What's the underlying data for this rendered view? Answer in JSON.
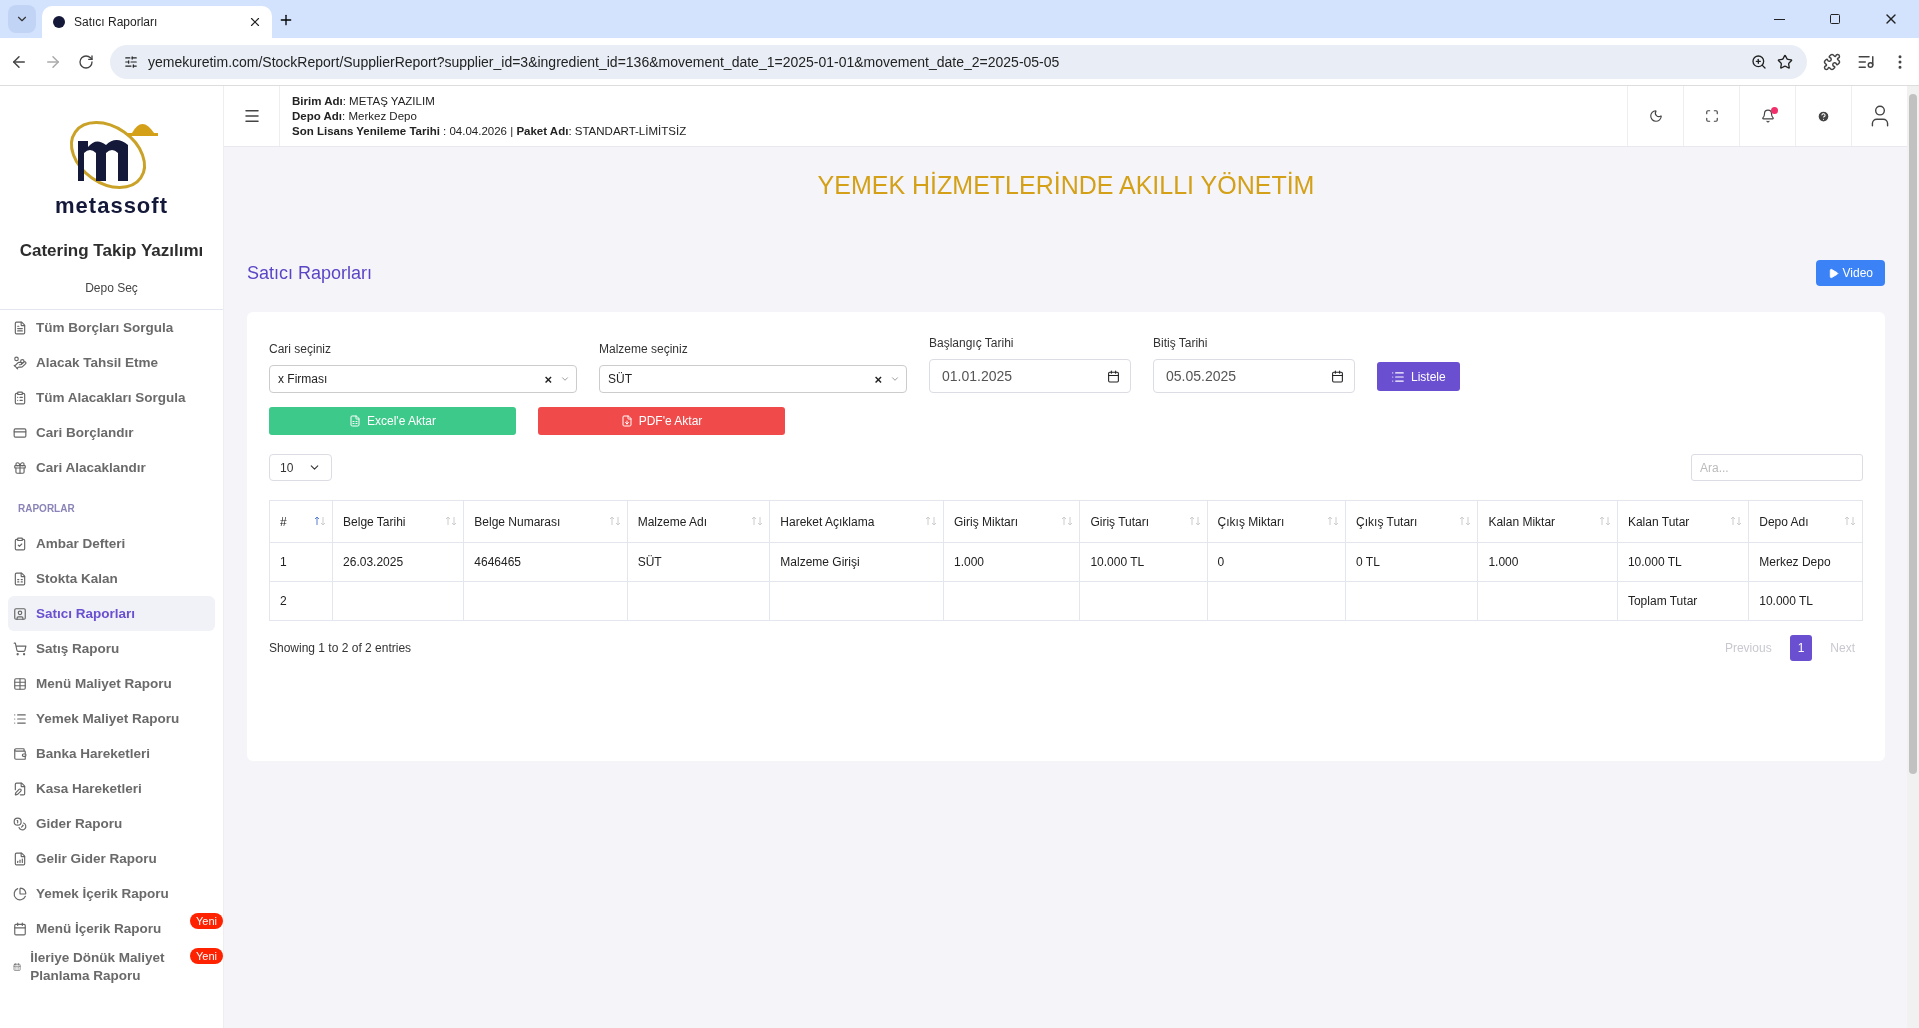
{
  "browser": {
    "tab_title": "Satıcı Raporları",
    "url": "yemekuretim.com/StockReport/SupplierReport?supplier_id=3&ingredient_id=136&movement_date_1=2025-01-01&movement_date_2=2025-05-05"
  },
  "sidebar": {
    "logo_text": "metassoft",
    "app_name": "Catering Takip Yazılımı",
    "depot_link": "Depo Seç",
    "items": [
      {
        "label": "Tüm Borçları Sorgula",
        "selected": false
      },
      {
        "label": "Alacak Tahsil Etme",
        "selected": false
      },
      {
        "label": "Tüm Alacakları Sorgula",
        "selected": false
      },
      {
        "label": "Cari Borçlandır",
        "selected": false
      },
      {
        "label": "Cari Alacaklandır",
        "selected": false
      },
      {
        "kind": "section",
        "label": "RAPORLAR"
      },
      {
        "label": "Ambar Defteri",
        "selected": false
      },
      {
        "label": "Stokta Kalan",
        "selected": false
      },
      {
        "label": "Satıcı Raporları",
        "selected": true
      },
      {
        "label": "Satış Raporu",
        "selected": false
      },
      {
        "label": "Menü Maliyet Raporu",
        "selected": false
      },
      {
        "label": "Yemek Maliyet Raporu",
        "selected": false
      },
      {
        "label": "Banka Hareketleri",
        "selected": false
      },
      {
        "label": "Kasa Hareketleri",
        "selected": false
      },
      {
        "label": "Gider Raporu",
        "selected": false
      },
      {
        "label": "Gelir Gider Raporu",
        "selected": false
      },
      {
        "label": "Yemek İçerik Raporu",
        "selected": false
      },
      {
        "label": "Menü İçerik Raporu",
        "selected": false,
        "badge": "Yeni"
      },
      {
        "label": "İleriye Dönük Maliyet Planlama Raporu",
        "selected": false,
        "badge": "Yeni"
      }
    ]
  },
  "header": {
    "info_lines": [
      "**Birim Adı**: METAŞ YAZILIM",
      "**Depo Adı**: Merkez Depo",
      "**Son Lisans Yenileme Tarihi** : 04.04.2026 | **Paket Adı**: STANDART-LİMİTSİZ"
    ],
    "notification_unread": true
  },
  "banner": "YEMEK HİZMETLERİNDE AKILLI YÖNETİM",
  "page_title": "Satıcı Raporları",
  "video_button": "Video",
  "filters": [
    {
      "kind": "select",
      "label": "Cari seçiniz",
      "value": "x Firması",
      "clear": "×"
    },
    {
      "kind": "select",
      "label": "Malzeme seçiniz",
      "value": "SÜT",
      "clear": "×"
    },
    {
      "kind": "date",
      "label": "Başlangıç Tarihi",
      "value": "01.01.2025"
    },
    {
      "kind": "date",
      "label": "Bitiş Tarihi",
      "value": "05.05.2025"
    }
  ],
  "list_button": "Listele",
  "excel_button": "Excel'e Aktar",
  "pdf_button": "PDF'e Aktar",
  "page_size": "10",
  "search": {
    "placeholder": "Ara..."
  },
  "table": {
    "columns": [
      {
        "label": "#",
        "sorted": true
      },
      {
        "label": "Belge Tarihi",
        "sorted": false
      },
      {
        "label": "Belge Numarası",
        "sorted": false
      },
      {
        "label": "Malzeme Adı",
        "sorted": false
      },
      {
        "label": "Hareket Açıklama",
        "sorted": false
      },
      {
        "label": "Giriş Miktarı",
        "sorted": false
      },
      {
        "label": "Giriş Tutarı",
        "sorted": false
      },
      {
        "label": "Çıkış Miktarı",
        "sorted": false
      },
      {
        "label": "Çıkış Tutarı",
        "sorted": false
      },
      {
        "label": "Kalan Miktar",
        "sorted": false
      },
      {
        "label": "Kalan Tutar",
        "sorted": false
      },
      {
        "label": "Depo Adı",
        "sorted": false
      }
    ],
    "rows": [
      [
        "1",
        "26.03.2025",
        "4646465",
        "SÜT",
        "Malzeme Girişi",
        "1.000",
        "10.000 TL",
        "0",
        "0 TL",
        "1.000",
        "10.000 TL",
        "Merkez Depo"
      ],
      [
        "2",
        "",
        "",
        "",
        "",
        "",
        "",
        "",
        "",
        "",
        "Toplam Tutar",
        "10.000 TL"
      ]
    ]
  },
  "entries_info": "Showing 1 to 2 of 2 entries",
  "pagination": [
    {
      "label": "Previous",
      "selected": false,
      "disabled": true
    },
    {
      "label": "1",
      "selected": true,
      "disabled": false
    },
    {
      "label": "Next",
      "selected": false,
      "disabled": true
    }
  ]
}
